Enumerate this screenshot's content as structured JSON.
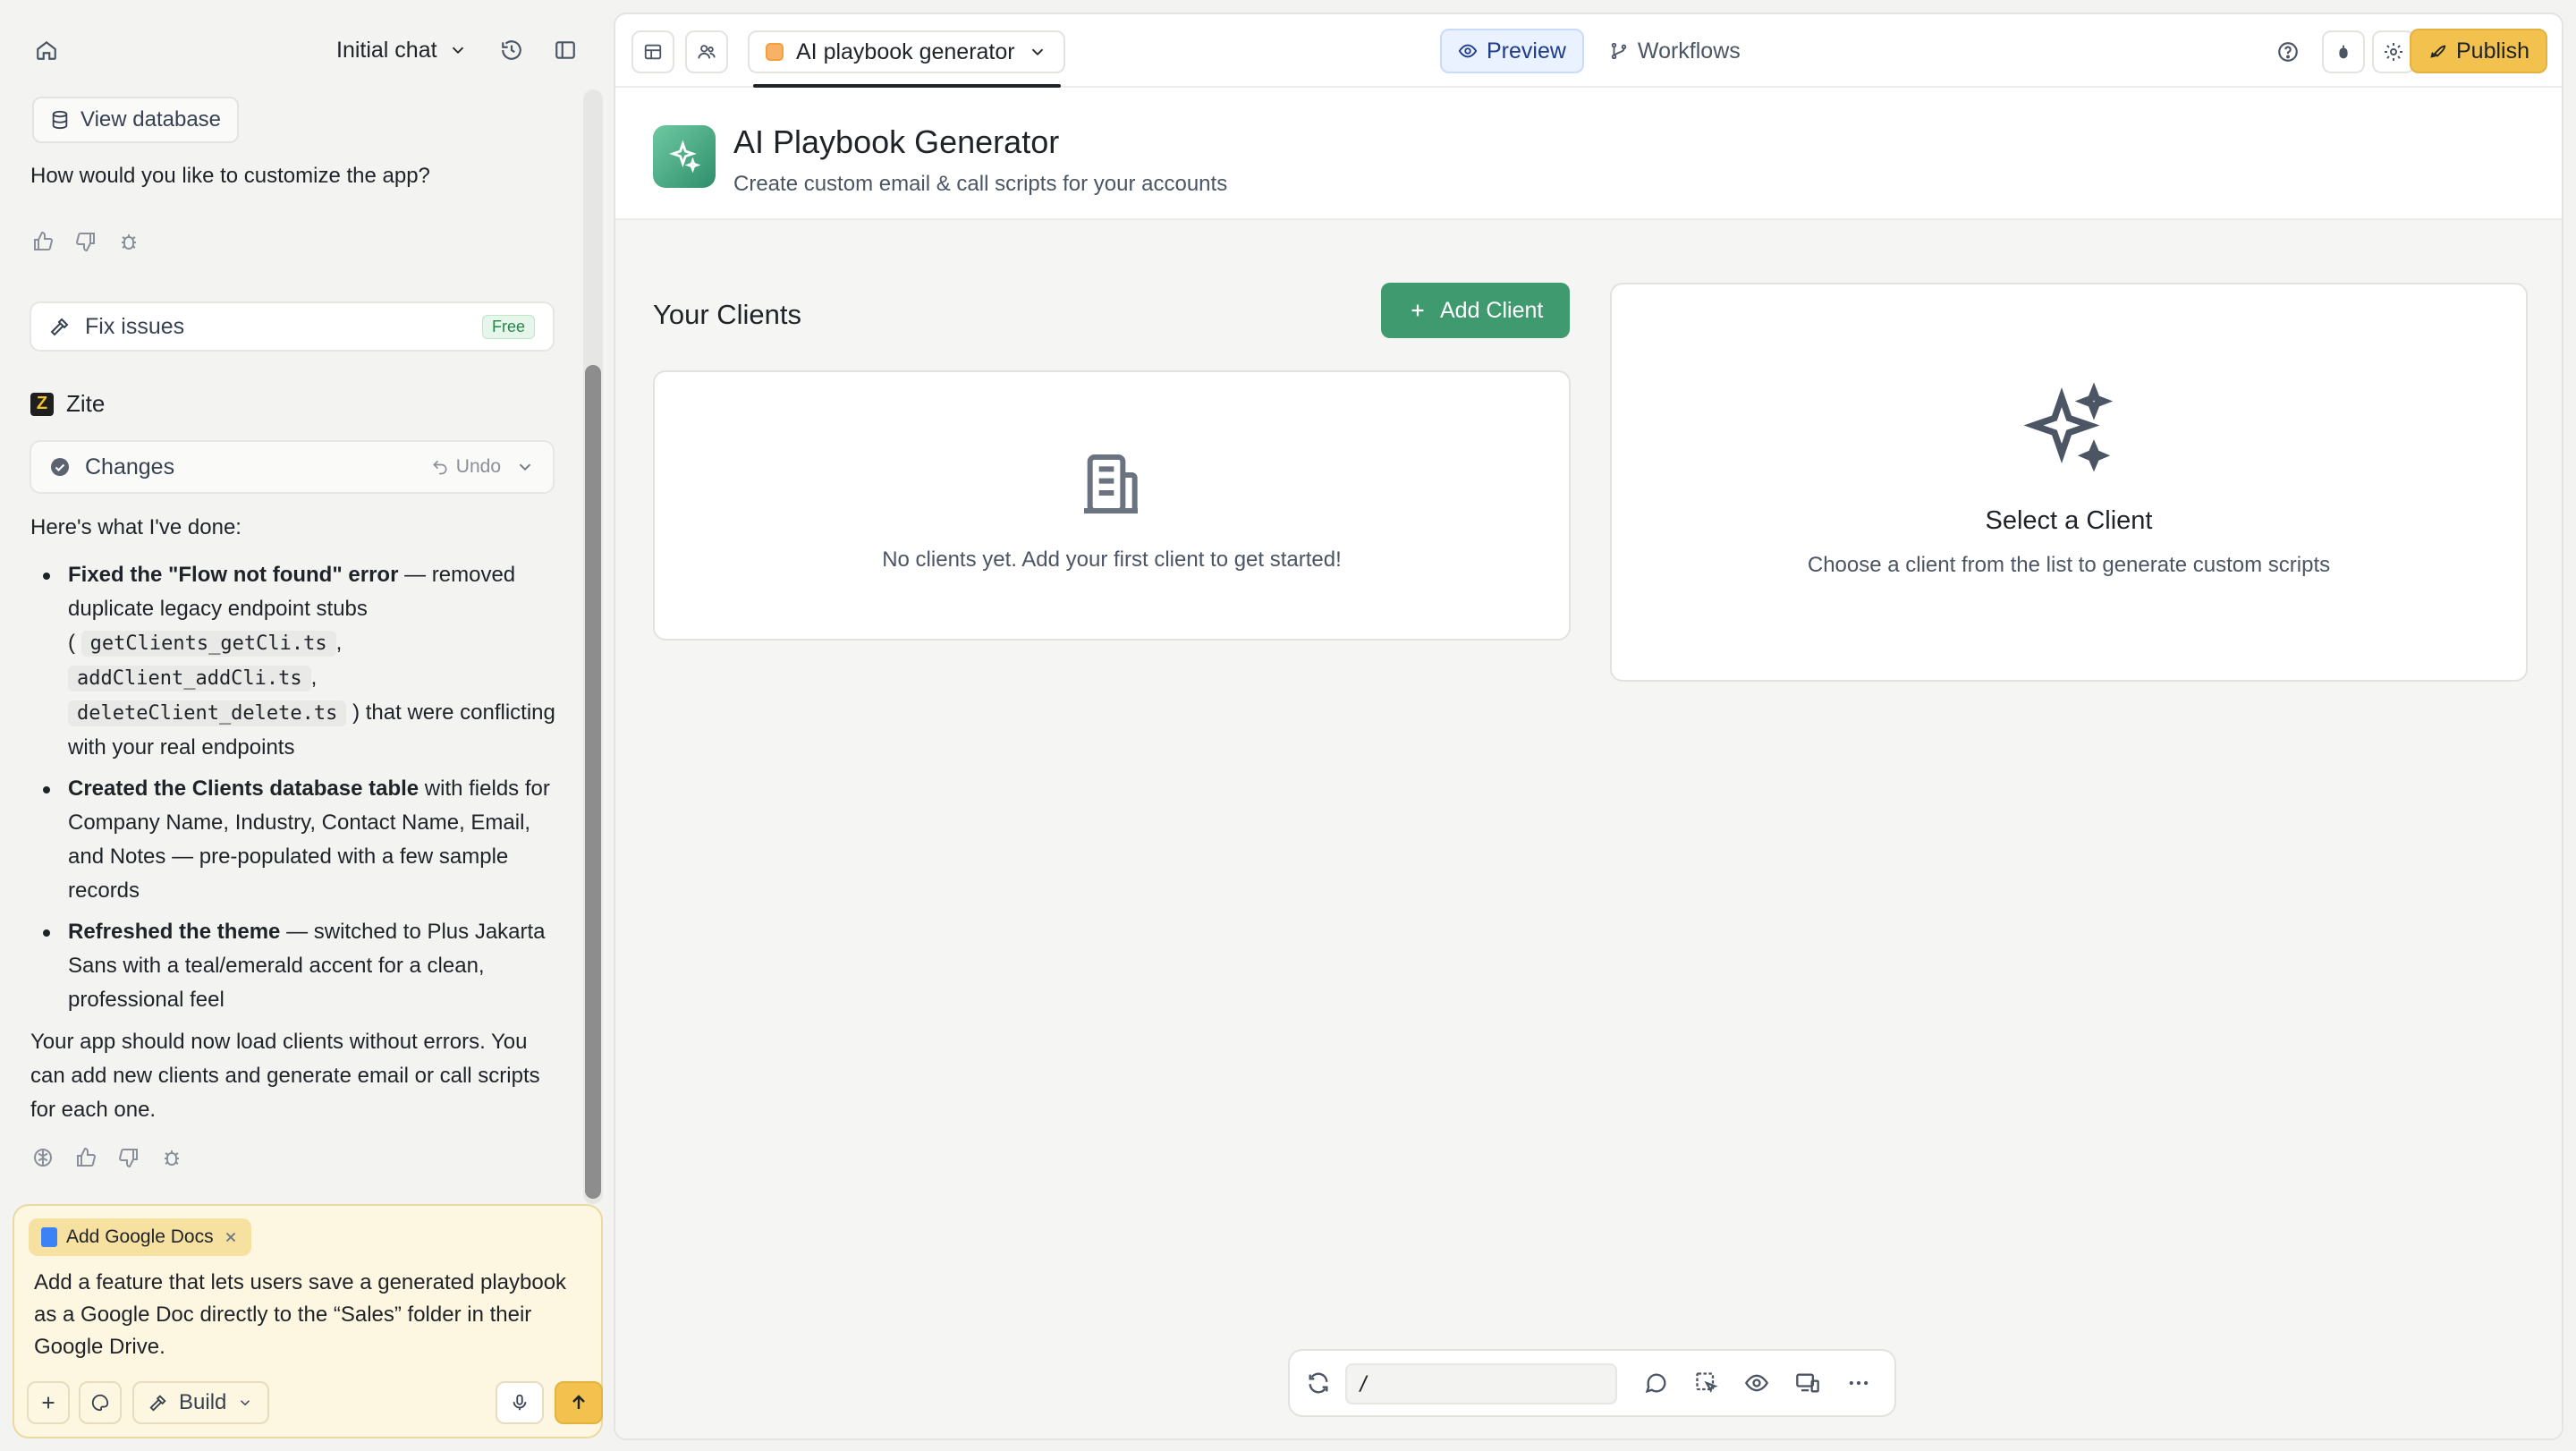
{
  "sidebar": {
    "chat_selector": "Initial chat",
    "view_database": "View database",
    "question": "How would you like to customize the app?",
    "fix_issues": "Fix issues",
    "fix_badge": "Free",
    "agent_name": "Zite",
    "agent_logo_letter": "Z",
    "changes_label": "Changes",
    "undo_label": "Undo",
    "done_intro": "Here's what I've done:",
    "bullets": [
      {
        "bold": "Fixed the \"Flow not found\" error",
        "text1": " — removed duplicate legacy endpoint stubs",
        "open_paren": "(",
        "code1": "getClients_getCli.ts",
        "code2": "addClient_addCli.ts",
        "code3": "deleteClient_delete.ts",
        "text2": ") that were conflicting with your real endpoints"
      },
      {
        "bold": "Created the Clients database table",
        "text": " with fields for Company Name, Industry, Contact Name, Email, and Notes — pre-populated with a few sample records"
      },
      {
        "bold": "Refreshed the theme",
        "text": " — switched to Plus Jakarta Sans with a teal/emerald accent for a clean, professional feel"
      }
    ],
    "outro": "Your app should now load clients without errors. You can add new clients and generate email or call scripts for each one.",
    "composer": {
      "tag": "Add Google Docs",
      "text": "Add a feature that lets users save a generated playbook as a Google Doc directly to the “Sales” folder in their Google Drive.",
      "mode": "Build"
    }
  },
  "toolbar": {
    "app_name": "AI playbook generator",
    "tabs": [
      {
        "label": "Preview",
        "active": true
      },
      {
        "label": "Workflows",
        "active": false
      }
    ],
    "publish": "Publish"
  },
  "app": {
    "title": "AI Playbook Generator",
    "subtitle": "Create custom email & call scripts for your accounts",
    "clients_heading": "Your Clients",
    "add_client": "Add Client",
    "empty_text": "No clients yet. Add your first client to get started!",
    "select_title": "Select a Client",
    "select_sub": "Choose a client from the list to generate custom scripts"
  },
  "bottom_bar": {
    "input_value": "/"
  },
  "colors": {
    "accent_green": "#3f9a6f",
    "publish_yellow": "#f2c14e",
    "preview_blue": "#1e3a8a"
  }
}
